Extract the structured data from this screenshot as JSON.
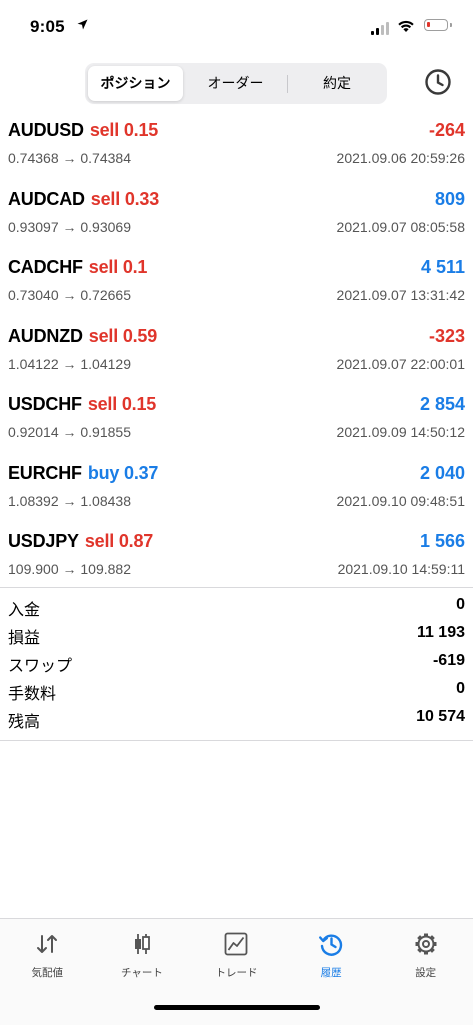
{
  "status_bar": {
    "time": "9:05"
  },
  "segments": [
    {
      "label": "ポジション",
      "active": true
    },
    {
      "label": "オーダー",
      "active": false
    },
    {
      "label": "約定",
      "active": false
    }
  ],
  "positions": [
    {
      "symbol": "AUDUSD",
      "direction": "sell 0.15",
      "side": "sell",
      "prices": "0.74368 → 0.74384",
      "profit": "-264",
      "timestamp": "2021.09.06 20:59:26"
    },
    {
      "symbol": "AUDCAD",
      "direction": "sell 0.33",
      "side": "sell",
      "prices": "0.93097 → 0.93069",
      "profit": "809",
      "timestamp": "2021.09.07 08:05:58"
    },
    {
      "symbol": "CADCHF",
      "direction": "sell 0.1",
      "side": "sell",
      "prices": "0.73040 → 0.72665",
      "profit": "4 511",
      "timestamp": "2021.09.07 13:31:42"
    },
    {
      "symbol": "AUDNZD",
      "direction": "sell 0.59",
      "side": "sell",
      "prices": "1.04122 → 1.04129",
      "profit": "-323",
      "timestamp": "2021.09.07 22:00:01"
    },
    {
      "symbol": "USDCHF",
      "direction": "sell 0.15",
      "side": "sell",
      "prices": "0.92014 → 0.91855",
      "profit": "2 854",
      "timestamp": "2021.09.09 14:50:12"
    },
    {
      "symbol": "EURCHF",
      "direction": "buy 0.37",
      "side": "buy",
      "prices": "1.08392 → 1.08438",
      "profit": "2 040",
      "timestamp": "2021.09.10 09:48:51"
    },
    {
      "symbol": "USDJPY",
      "direction": "sell 0.87",
      "side": "sell",
      "prices": "109.900 → 109.882",
      "profit": "1 566",
      "timestamp": "2021.09.10 14:59:11"
    }
  ],
  "summary": [
    {
      "label": "入金",
      "value": "0"
    },
    {
      "label": "損益",
      "value": "11 193"
    },
    {
      "label": "スワップ",
      "value": "-619"
    },
    {
      "label": "手数料",
      "value": "0"
    },
    {
      "label": "残高",
      "value": "10 574"
    }
  ],
  "tabs": [
    {
      "label": "気配値",
      "icon": "quotes-arrows-icon",
      "active": false
    },
    {
      "label": "チャート",
      "icon": "candlestick-chart-icon",
      "active": false
    },
    {
      "label": "トレード",
      "icon": "trade-chart-icon",
      "active": false
    },
    {
      "label": "履歴",
      "icon": "history-clock-icon",
      "active": true
    },
    {
      "label": "設定",
      "icon": "gear-icon",
      "active": false
    }
  ],
  "colors": {
    "sell": "#e0352b",
    "buy": "#1a7de6",
    "accent": "#1a7de6"
  }
}
